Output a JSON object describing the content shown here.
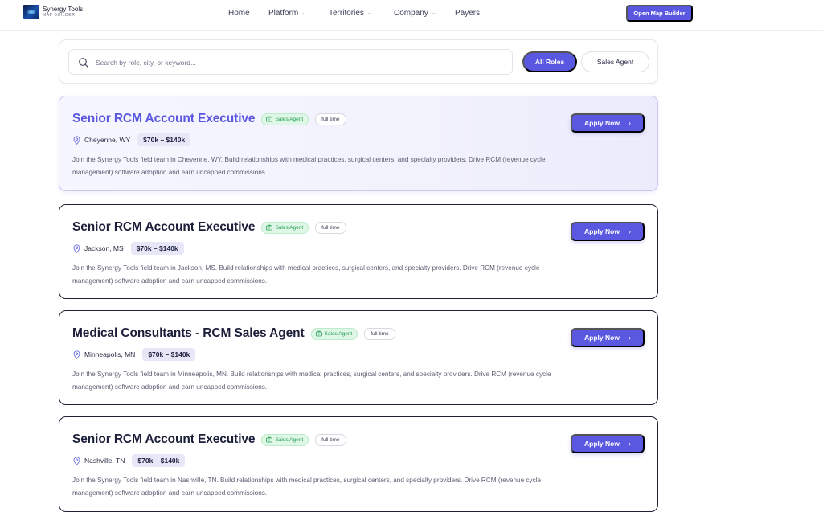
{
  "brand": {
    "name": "Synergy Tools",
    "tagline": "MAP BUILDER"
  },
  "nav": {
    "items": [
      {
        "label": "Home",
        "has_dropdown": false
      },
      {
        "label": "Platform",
        "has_dropdown": true
      },
      {
        "label": "Territories",
        "has_dropdown": true
      },
      {
        "label": "Company",
        "has_dropdown": true
      },
      {
        "label": "Payers",
        "has_dropdown": false
      }
    ],
    "cta_label": "Open Map Builder"
  },
  "search": {
    "placeholder": "Search by role, city, or keyword...",
    "value": "",
    "filters": [
      {
        "label": "All Roles",
        "active": true
      },
      {
        "label": "Sales Agent",
        "active": false
      }
    ]
  },
  "jobs": [
    {
      "title": "Senior RCM Account Executive",
      "category": "Sales Agent",
      "type": "full time",
      "location": "Cheyenne, WY",
      "salary": "$70k – $140k",
      "description": "Join the Synergy Tools field team in Cheyenne, WY. Build relationships with medical practices, surgical centers, and specialty providers. Drive RCM (revenue cycle management) software adoption and earn uncapped commissions.",
      "apply_label": "Apply Now",
      "highlighted": true
    },
    {
      "title": "Senior RCM Account Executive",
      "category": "Sales Agent",
      "type": "full time",
      "location": "Jackson, MS",
      "salary": "$70k – $140k",
      "description": "Join the Synergy Tools field team in Jackson, MS. Build relationships with medical practices, surgical centers, and specialty providers. Drive RCM (revenue cycle management) software adoption and earn uncapped commissions.",
      "apply_label": "Apply Now",
      "highlighted": false
    },
    {
      "title": "Medical Consultants - RCM Sales Agent",
      "category": "Sales Agent",
      "type": "full time",
      "location": "Minneapolis, MN",
      "salary": "$70k – $140k",
      "description": "Join the Synergy Tools field team in Minneapolis, MN. Build relationships with medical practices, surgical centers, and specialty providers. Drive RCM (revenue cycle management) software adoption and earn uncapped commissions.",
      "apply_label": "Apply Now",
      "highlighted": false
    },
    {
      "title": "Senior RCM Account Executive",
      "category": "Sales Agent",
      "type": "full time",
      "location": "Nashville, TN",
      "salary": "$70k – $140k",
      "description": "Join the Synergy Tools field team in Nashville, TN. Build relationships with medical practices, surgical centers, and specialty providers. Drive RCM (revenue cycle management) software adoption and earn uncapped commissions.",
      "apply_label": "Apply Now",
      "highlighted": false
    }
  ],
  "colors": {
    "accent": "#5a57e0",
    "badge_green_bg": "#dff7e6",
    "badge_green_text": "#1f9d4f",
    "title_dark": "#1c1f3a"
  },
  "icons": {
    "search": "search-icon",
    "location": "map-pin-icon",
    "category": "briefcase-icon",
    "apply": "chevron-right-icon",
    "nav_dropdown": "chevron-down-icon"
  }
}
